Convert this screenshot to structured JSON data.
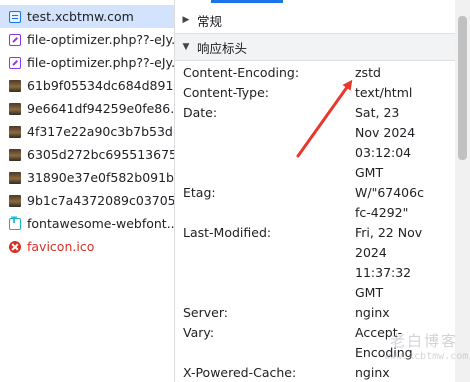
{
  "requests": [
    {
      "name": "test.xcbtmw.com",
      "icon": "document-icon",
      "selected": true,
      "error": false
    },
    {
      "name": "file-optimizer.php??-eJy...",
      "icon": "script-icon",
      "selected": false,
      "error": false
    },
    {
      "name": "file-optimizer.php??-eJy...",
      "icon": "script-icon",
      "selected": false,
      "error": false
    },
    {
      "name": "61b9f05534dc684d891...",
      "icon": "image-icon",
      "selected": false,
      "error": false
    },
    {
      "name": "9e6641df94259e0fe86...",
      "icon": "image-icon",
      "selected": false,
      "error": false
    },
    {
      "name": "4f317e22a90c3b7b53d...",
      "icon": "image-icon",
      "selected": false,
      "error": false
    },
    {
      "name": "6305d272bc695513675...",
      "icon": "image-icon",
      "selected": false,
      "error": false
    },
    {
      "name": "31890e37e0f582b091b...",
      "icon": "image-icon",
      "selected": false,
      "error": false
    },
    {
      "name": "9b1c7a4372089c03705...",
      "icon": "image-icon",
      "selected": false,
      "error": false
    },
    {
      "name": "fontawesome-webfont....",
      "icon": "font-icon",
      "selected": false,
      "error": false
    },
    {
      "name": "favicon.ico",
      "icon": "error-icon",
      "selected": false,
      "error": true
    }
  ],
  "sections": {
    "general": {
      "label": "常规",
      "expanded": false
    },
    "response_headers": {
      "label": "响应标头",
      "expanded": true
    }
  },
  "headers": [
    {
      "name": "Content-Encoding:",
      "value": [
        "zstd"
      ]
    },
    {
      "name": "Content-Type:",
      "value": [
        "text/html"
      ]
    },
    {
      "name": "Date:",
      "value": [
        "Sat, 23",
        "Nov 2024",
        "03:12:04",
        "GMT"
      ]
    },
    {
      "name": "Etag:",
      "value": [
        "W/\"67406c",
        "fc-4292\""
      ]
    },
    {
      "name": "Last-Modified:",
      "value": [
        "Fri, 22 Nov",
        "2024",
        "11:37:32",
        "GMT"
      ]
    },
    {
      "name": "Server:",
      "value": [
        "nginx"
      ]
    },
    {
      "name": "Vary:",
      "value": [
        "Accept-",
        "Encoding"
      ]
    },
    {
      "name": "X-Powered-Cache:",
      "value": [
        "nginx"
      ]
    }
  ],
  "watermark": {
    "cn": "老白博客",
    "url": "www.xcbtmw.com"
  },
  "colors": {
    "accent": "#1a73e8",
    "selected_row": "#d3e3fd",
    "error": "#d93025",
    "arrow": "#e8372c"
  }
}
